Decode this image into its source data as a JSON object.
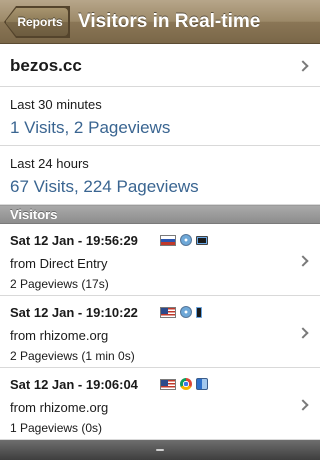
{
  "navbar": {
    "back_label": "Reports",
    "title": "Visitors in Real-time"
  },
  "site": {
    "name": "bezos.cc"
  },
  "stats": {
    "last_30": {
      "label": "Last 30 minutes",
      "value": "1 Visits, 2 Pageviews"
    },
    "last_24": {
      "label": "Last 24 hours",
      "value": "67 Visits, 224 Pageviews"
    }
  },
  "visitors_header": "Visitors",
  "visitors": [
    {
      "time": "Sat 12 Jan - 19:56:29",
      "from": "from Direct Entry",
      "pageviews": "2 Pageviews (17s)",
      "icons": [
        "russia-flag-icon",
        "safari-icon",
        "ipad-icon"
      ]
    },
    {
      "time": "Sat 12 Jan - 19:10:22",
      "from": "from rhizome.org",
      "pageviews": "2 Pageviews (1 min 0s)",
      "icons": [
        "us-flag-icon",
        "safari-icon",
        "iphone-icon"
      ]
    },
    {
      "time": "Sat 12 Jan - 19:06:04",
      "from": "from rhizome.org",
      "pageviews": "1 Pageviews (0s)",
      "icons": [
        "us-flag-icon",
        "chrome-icon",
        "finder-icon"
      ]
    }
  ],
  "colors": {
    "navbar": "#9c8968",
    "link_value": "#3a6591",
    "section_header": "#999999"
  }
}
